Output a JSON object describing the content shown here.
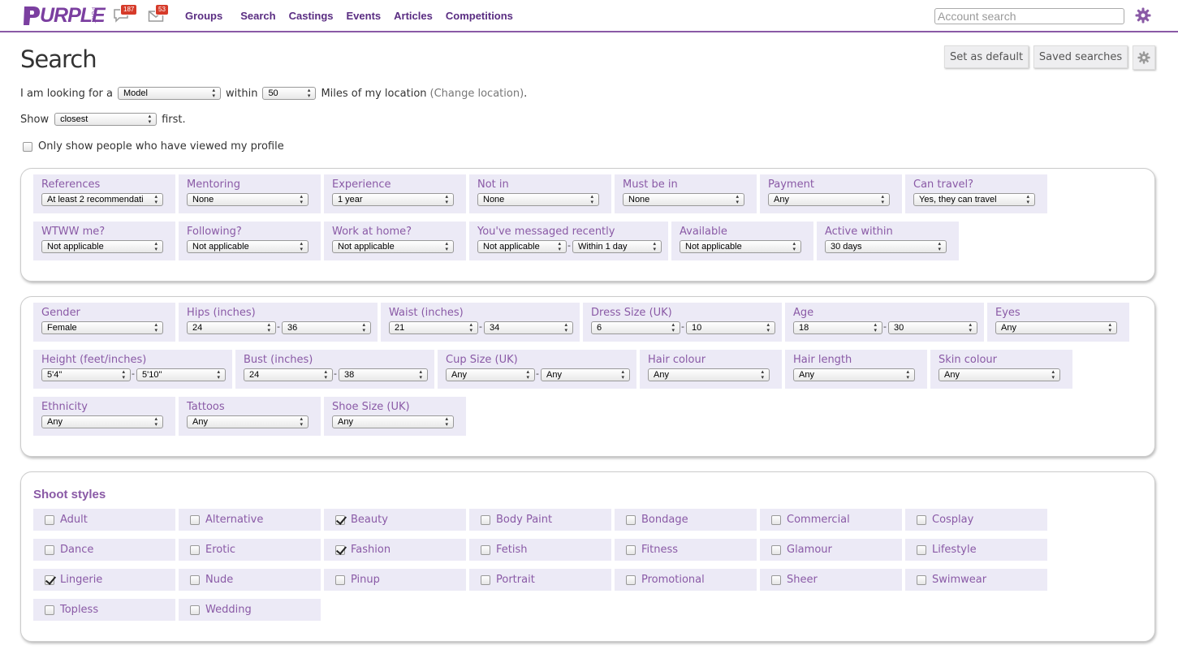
{
  "header": {
    "logo_text": "URPLE",
    "logo_side": "PORT",
    "messages_count": "187",
    "mail_count": "53",
    "nav": [
      "Groups",
      "Search",
      "Castings",
      "Events",
      "Articles",
      "Competitions"
    ],
    "account_search_placeholder": "Account search"
  },
  "page": {
    "title": "Search",
    "set_default": "Set as default",
    "saved_searches": "Saved searches"
  },
  "criteria": {
    "looking_for_prefix": "I am looking for a",
    "looking_for_value": "Model",
    "within_label": "within",
    "distance_value": "50",
    "miles_label": "Miles of my location",
    "change_location": "(Change location)",
    "period": ".",
    "show_label": "Show",
    "order_value": "closest",
    "first_label": "first.",
    "viewed_label": "Only show people who have viewed my profile"
  },
  "filters": [
    {
      "label": "References",
      "values": [
        "At least 2 recommendati"
      ]
    },
    {
      "label": "Mentoring",
      "values": [
        "None"
      ]
    },
    {
      "label": "Experience",
      "values": [
        "1 year"
      ]
    },
    {
      "label": "Not in",
      "values": [
        "None"
      ]
    },
    {
      "label": "Must be in",
      "values": [
        "None"
      ]
    },
    {
      "label": "Payment",
      "values": [
        "Any"
      ]
    },
    {
      "label": "Can travel?",
      "values": [
        "Yes, they can travel"
      ]
    },
    {
      "label": "WTWW me?",
      "values": [
        "Not applicable"
      ]
    },
    {
      "label": "Following?",
      "values": [
        "Not applicable"
      ]
    },
    {
      "label": "Work at home?",
      "values": [
        "Not applicable"
      ]
    },
    {
      "label": "You've messaged recently",
      "values": [
        "Not applicable",
        "Within 1 day"
      ]
    },
    {
      "label": "Available",
      "values": [
        "Not applicable"
      ]
    },
    {
      "label": "Active within",
      "values": [
        "30 days"
      ]
    }
  ],
  "attributes": [
    {
      "label": "Gender",
      "values": [
        "Female"
      ]
    },
    {
      "label": "Hips (inches)",
      "values": [
        "24",
        "36"
      ]
    },
    {
      "label": "Waist (inches)",
      "values": [
        "21",
        "34"
      ]
    },
    {
      "label": "Dress Size (UK)",
      "values": [
        "6",
        "10"
      ]
    },
    {
      "label": "Age",
      "values": [
        "18",
        "30"
      ]
    },
    {
      "label": "Eyes",
      "values": [
        "Any"
      ]
    },
    {
      "label": "Height (feet/inches)",
      "values": [
        "5'4\"",
        "5'10\""
      ]
    },
    {
      "label": "Bust (inches)",
      "values": [
        "24",
        "38"
      ]
    },
    {
      "label": "Cup Size (UK)",
      "values": [
        "Any",
        "Any"
      ]
    },
    {
      "label": "Hair colour",
      "values": [
        "Any"
      ]
    },
    {
      "label": "Hair length",
      "values": [
        "Any"
      ]
    },
    {
      "label": "Skin colour",
      "values": [
        "Any"
      ]
    },
    {
      "label": "Ethnicity",
      "values": [
        "Any"
      ]
    },
    {
      "label": "Tattoos",
      "values": [
        "Any"
      ]
    },
    {
      "label": "Shoe Size (UK)",
      "values": [
        "Any"
      ]
    }
  ],
  "shoot_styles": {
    "title": "Shoot styles",
    "items": [
      {
        "label": "Adult",
        "checked": false
      },
      {
        "label": "Alternative",
        "checked": false
      },
      {
        "label": "Beauty",
        "checked": true
      },
      {
        "label": "Body Paint",
        "checked": false
      },
      {
        "label": "Bondage",
        "checked": false
      },
      {
        "label": "Commercial",
        "checked": false
      },
      {
        "label": "Cosplay",
        "checked": false
      },
      {
        "label": "Dance",
        "checked": false
      },
      {
        "label": "Erotic",
        "checked": false
      },
      {
        "label": "Fashion",
        "checked": true
      },
      {
        "label": "Fetish",
        "checked": false
      },
      {
        "label": "Fitness",
        "checked": false
      },
      {
        "label": "Glamour",
        "checked": false
      },
      {
        "label": "Lifestyle",
        "checked": false
      },
      {
        "label": "Lingerie",
        "checked": true
      },
      {
        "label": "Nude",
        "checked": false
      },
      {
        "label": "Pinup",
        "checked": false
      },
      {
        "label": "Portrait",
        "checked": false
      },
      {
        "label": "Promotional",
        "checked": false
      },
      {
        "label": "Sheer",
        "checked": false
      },
      {
        "label": "Swimwear",
        "checked": false
      },
      {
        "label": "Topless",
        "checked": false
      },
      {
        "label": "Wedding",
        "checked": false
      }
    ]
  },
  "colors": {
    "accent": "#8a5aa6",
    "nav": "#5a2d82",
    "cell_bg": "#eceaf6",
    "badge": "#d63b2a"
  }
}
